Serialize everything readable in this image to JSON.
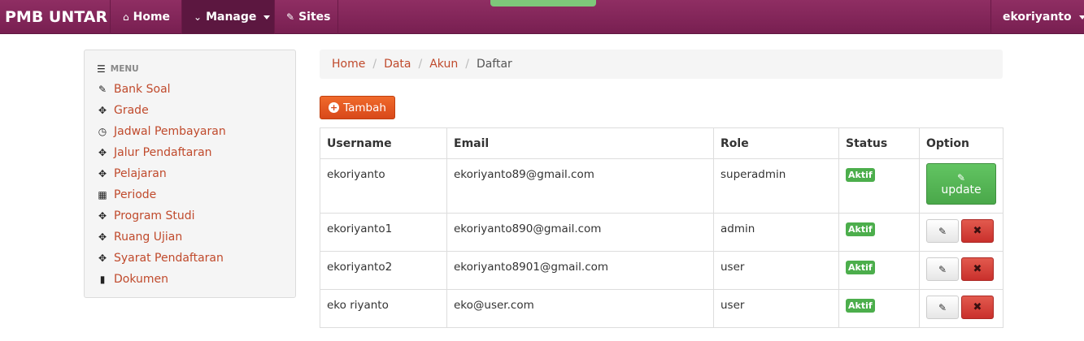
{
  "navbar": {
    "brand": "PMB UNTAR",
    "items": [
      {
        "label": "Home",
        "icon": "home-icon"
      },
      {
        "label": "Manage",
        "icon": "chevron-down-icon"
      },
      {
        "label": "Sites",
        "icon": "pencil-icon"
      }
    ],
    "user": "ekoriyanto"
  },
  "sidebar": {
    "header": "MENU",
    "items": [
      {
        "label": "Bank Soal",
        "icon": "pencil-icon"
      },
      {
        "label": "Grade",
        "icon": "move-icon"
      },
      {
        "label": "Jadwal Pembayaran",
        "icon": "clock-icon"
      },
      {
        "label": "Jalur Pendaftaran",
        "icon": "move-icon"
      },
      {
        "label": "Pelajaran",
        "icon": "move-icon"
      },
      {
        "label": "Periode",
        "icon": "calendar-icon"
      },
      {
        "label": "Program Studi",
        "icon": "move-icon"
      },
      {
        "label": "Ruang Ujian",
        "icon": "move-icon"
      },
      {
        "label": "Syarat Pendaftaran",
        "icon": "move-icon"
      },
      {
        "label": "Dokumen",
        "icon": "book-icon"
      }
    ]
  },
  "breadcrumb": [
    "Home",
    "Data",
    "Akun",
    "Daftar"
  ],
  "tambah_label": "Tambah",
  "table": {
    "headers": [
      "Username",
      "Email",
      "Role",
      "Status",
      "Option"
    ],
    "rows": [
      {
        "username": "ekoriyanto",
        "email": "ekoriyanto89@gmail.com",
        "role": "superadmin",
        "status": "Aktif"
      },
      {
        "username": "ekoriyanto1",
        "email": "ekoriyanto890@gmail.com",
        "role": "admin",
        "status": "Aktif"
      },
      {
        "username": "ekoriyanto2",
        "email": "ekoriyanto8901@gmail.com",
        "role": "user",
        "status": "Aktif"
      },
      {
        "username": "eko riyanto",
        "email": "eko@user.com",
        "role": "user",
        "status": "Aktif"
      }
    ],
    "update_label": "update"
  },
  "colors": {
    "navbar": "#8f2e63",
    "link": "#c04a2c",
    "tambah": "#e85a24",
    "badge": "#4cae4c",
    "delete": "#c9302c"
  }
}
